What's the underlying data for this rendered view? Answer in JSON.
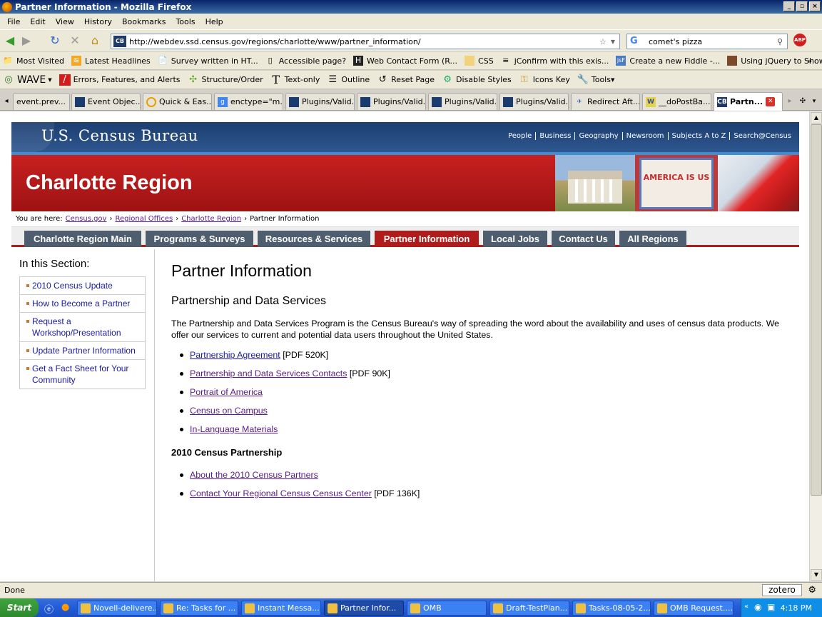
{
  "window": {
    "title": "Partner Information - Mozilla Firefox"
  },
  "menu": [
    "File",
    "Edit",
    "View",
    "History",
    "Bookmarks",
    "Tools",
    "Help"
  ],
  "nav": {
    "url": "http://webdev.ssd.census.gov/regions/charlotte/www/partner_information/",
    "search_value": "comet's pizza"
  },
  "bookmarks": [
    "Most Visited",
    "Latest Headlines",
    "Survey written in HT...",
    "Accessible page?",
    "Web Contact Form (R...",
    "CSS",
    "jConfirm with this exis...",
    "Create a new Fiddle -...",
    "Using jQuery to Show..."
  ],
  "wave": {
    "label": "WAVE",
    "items": [
      "Errors, Features, and Alerts",
      "Structure/Order",
      "Text-only",
      "Outline",
      "Reset Page",
      "Disable Styles",
      "Icons Key",
      "Tools"
    ]
  },
  "tabs": [
    "event.prev...",
    "Event Objec...",
    "Quick & Eas...",
    "enctype=\"m...",
    "Plugins/Valid...",
    "Plugins/Valid...",
    "Plugins/Valid...",
    "Plugins/Valid...",
    "Redirect Aft...",
    "__doPostBa...",
    "Partn..."
  ],
  "page": {
    "header": {
      "logo": "U.S. Census Bureau",
      "links": [
        "People",
        "Business",
        "Geography",
        "Newsroom",
        "Subjects A to Z",
        "Search@Census"
      ]
    },
    "region_title": "Charlotte Region",
    "banner_text": "AMERICA IS US",
    "breadcrumb": {
      "prefix": "You are here:",
      "links": [
        "Census.gov",
        "Regional Offices",
        "Charlotte Region"
      ],
      "current": "Partner Information"
    },
    "nav_tabs": [
      "Charlotte Region Main",
      "Programs & Surveys",
      "Resources & Services",
      "Partner Information",
      "Local Jobs",
      "Contact Us",
      "All Regions"
    ],
    "sidebar": {
      "title": "In this Section:",
      "items": [
        "2010 Census Update",
        "How to Become a Partner",
        "Request a Workshop/Presentation",
        "Update Partner Information",
        "Get a Fact Sheet for Your Community"
      ]
    },
    "main": {
      "title": "Partner Information",
      "section1_title": "Partnership and Data Services",
      "intro": "The Partnership and Data Services Program is the Census Bureau's way of spreading the word about the availability and uses of census data products. We offer our services to current and potential data users throughout the United States.",
      "links1": [
        {
          "text": "Partnership Agreement",
          "note": "[PDF 520K]"
        },
        {
          "text": "Partnership and Data Services Contacts",
          "note": "[PDF 90K]"
        },
        {
          "text": "Portrait of America",
          "note": ""
        },
        {
          "text": "Census on Campus",
          "note": ""
        },
        {
          "text": "In-Language Materials",
          "note": ""
        }
      ],
      "section2_title": "2010 Census Partnership",
      "links2": [
        {
          "text": "About the 2010 Census Partners",
          "note": ""
        },
        {
          "text": "Contact Your Regional Census Census Center",
          "note": "[PDF 136K]"
        }
      ]
    }
  },
  "status": {
    "text": "Done",
    "zotero": "zotero"
  },
  "taskbar": {
    "start": "Start",
    "items": [
      "Novell-delivere...",
      "Re: Tasks for ...",
      "Instant Messa...",
      "Partner Infor...",
      "OMB",
      "Draft-TestPlan...",
      "Tasks-08-05-2...",
      "OMB Request...."
    ],
    "clock": "4:18 PM"
  }
}
